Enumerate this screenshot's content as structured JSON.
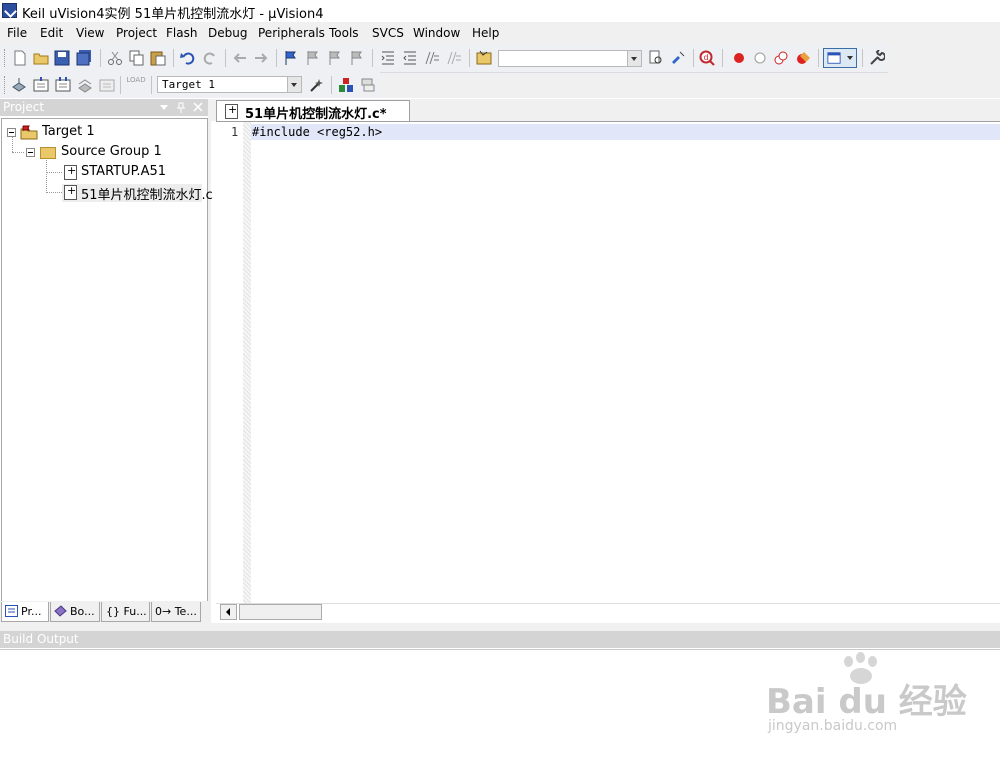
{
  "window": {
    "title": "Keil uVision4实例 51单片机控制流水灯  - µVision4"
  },
  "menu": [
    "File",
    "Edit",
    "View",
    "Project",
    "Flash",
    "Debug",
    "Peripherals",
    "Tools",
    "SVCS",
    "Window",
    "Help"
  ],
  "toolbar": {
    "target_select": "Target 1",
    "find_select": "",
    "load_label": "LOAD"
  },
  "project_panel": {
    "title": "Project",
    "tree": {
      "target": "Target 1",
      "group": "Source Group 1",
      "files": [
        "STARTUP.A51",
        "51单片机控制流水灯.c"
      ]
    },
    "tabs": [
      "Pr...",
      "Bo...",
      "{} Fu...",
      "0→ Te..."
    ]
  },
  "editor": {
    "tab_label": "51单片机控制流水灯.c*",
    "lines": [
      {
        "num": "1",
        "text": "#include <reg52.h>"
      }
    ]
  },
  "build_output": {
    "title": "Build Output"
  },
  "watermark": {
    "brand": "Bai du 经验",
    "url": "jingyan.baidu.com"
  }
}
